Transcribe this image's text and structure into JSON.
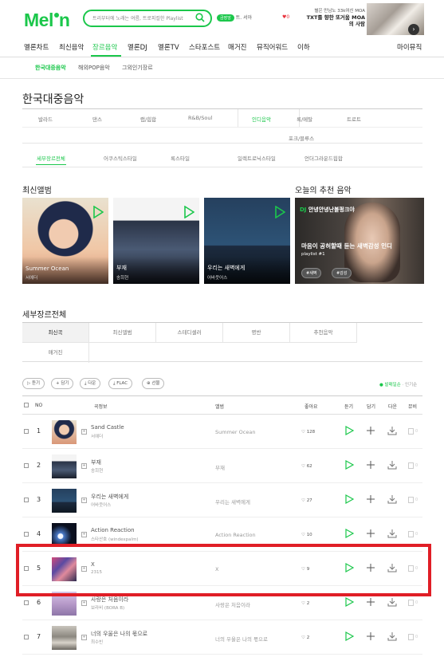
{
  "header": {
    "logo": "Mel",
    "logo_tail": "n",
    "search_placeholder": "트리부터에 노래는 여름, 트로피컬한 Playlist",
    "user_badge": "금장앙",
    "user_name": "트. 서아",
    "alert": "♥0",
    "ad_line1": "별은 만남노 33k여신 MOA",
    "ad_line2": "TXT를 향한 또거움 MOA의 사람"
  },
  "gnb": [
    "멜론차트",
    "최신음악",
    "장르음악",
    "멜론DJ",
    "멜론TV",
    "스타포스트",
    "매거진",
    "뮤직어워드",
    "이하",
    "마이뮤직"
  ],
  "sub_gnb": [
    "한국대중음악",
    "해외POP음악",
    "그외인기장르"
  ],
  "page_title": "한국대중음악",
  "genres_row1": [
    "발라드",
    "댄스",
    "랩/힙합",
    "R&B/Soul",
    "인디음악",
    "록/메탈",
    "트로트"
  ],
  "genres_row2": [
    "포크/블루스"
  ],
  "detail_genres": [
    "세부장르전체",
    "어쿠스틱스타일",
    "록스타일",
    "일렉트로닉스타일",
    "언더그라운드힙합"
  ],
  "new_albums_title": "최신앨범",
  "recommend_title": "오늘의 추천 음악",
  "albums": [
    {
      "title": "Summer Ocean",
      "artist": "서예더"
    },
    {
      "title": "부재",
      "artist": "송희현"
    },
    {
      "title": "우리는 새벽에게",
      "artist": "어바웃어스"
    }
  ],
  "recommend": {
    "dj": "DJ",
    "header": "안녕안녕난볼펑크야",
    "text1": "마음이 공허할때 듣는 새벽감성 인디",
    "text2": "playlist #1",
    "tag1": "#새벽",
    "tag2": "#감성"
  },
  "detail_section_title": "세부장르전체",
  "tabs": [
    "최신곡",
    "최신앨범",
    "스테디셀러",
    "명반",
    "추천음악",
    "매거진"
  ],
  "toolbar": [
    "듣기",
    "담기",
    "다운",
    "FLAC",
    "선물"
  ],
  "sort": {
    "on": "● 발매일순",
    "off": "· 인기순"
  },
  "table_headers": {
    "no": "NO",
    "song": "곡정보",
    "album": "앨범",
    "like": "좋아요",
    "listen": "듣기",
    "add": "담기",
    "down": "다운",
    "mv": "뮤비"
  },
  "rows": [
    {
      "no": "1",
      "title": "Sand Castle",
      "artist": "서예더",
      "album": "Summer Ocean",
      "likes": "128"
    },
    {
      "no": "2",
      "title": "부재",
      "artist": "송희현",
      "album": "부재",
      "likes": "62"
    },
    {
      "no": "3",
      "title": "우리는 새벽에게",
      "artist": "어바웃어스",
      "album": "우리는 새벽에게",
      "likes": "27"
    },
    {
      "no": "4",
      "title": "Action Reaction",
      "artist": "스타산호 (windexpalm)",
      "album": "Action Reaction",
      "likes": "10"
    },
    {
      "no": "5",
      "title": "X",
      "artist": "2315",
      "album": "X",
      "likes": "9"
    },
    {
      "no": "6",
      "title": "사랑은 처음이라",
      "artist": "보라비 (BORA B)",
      "album": "사랑은 처음이라",
      "likes": "2"
    },
    {
      "no": "7",
      "title": "너의 우울은 나의 몫으로",
      "artist": "최수빈",
      "album": "너의 우울은 나의 몫으로",
      "likes": "2"
    }
  ],
  "mv_count": "0",
  "colors": {
    "brand": "#1bc74b",
    "highlight": "#e01e26"
  }
}
